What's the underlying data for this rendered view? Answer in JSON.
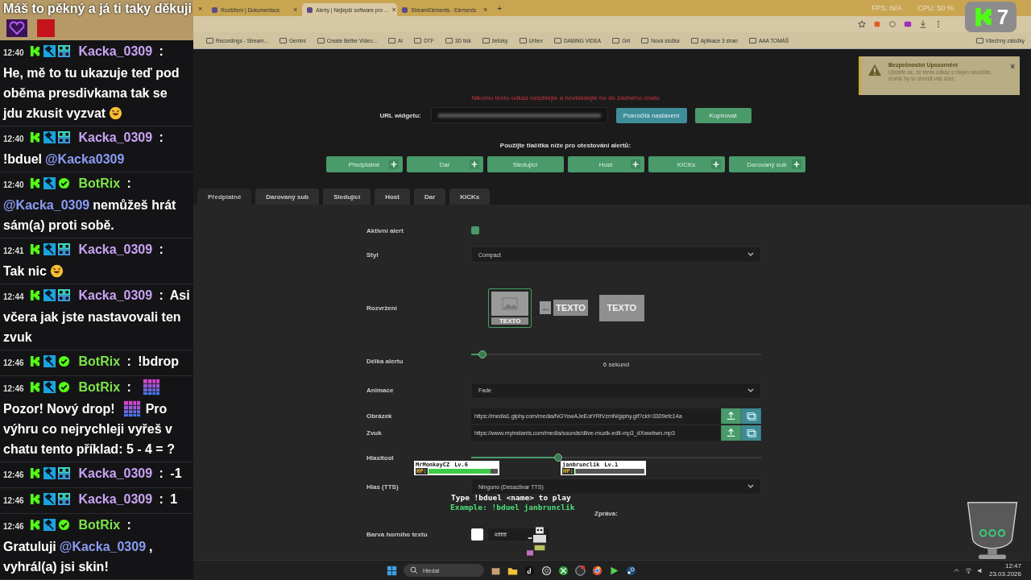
{
  "chat": {
    "header": "Máš to pěkný a já ti taky děkuji",
    "messages": [
      {
        "time": "12:40",
        "badges": [
          {
            "kind": "kick"
          },
          {
            "kind": "mod"
          },
          {
            "kind": "og"
          }
        ],
        "user": "Kacka_0309",
        "color": "#c9a3f2",
        "separator": ":",
        "parts": [
          {
            "kind": "text",
            "text": "He, mě to tu ukazuje teď pod oběma presdivkama tak se jdu zkusit vyzvat"
          },
          {
            "kind": "laugh-emote"
          }
        ]
      },
      {
        "time": "12:40",
        "badges": [
          {
            "kind": "kick"
          },
          {
            "kind": "mod"
          },
          {
            "kind": "og"
          }
        ],
        "user": "Kacka_0309",
        "color": "#c9a3f2",
        "separator": ":",
        "parts": [
          {
            "kind": "text",
            "text": "!bduel"
          },
          {
            "kind": "mention",
            "text": "@Kacka0309"
          }
        ]
      },
      {
        "time": "12:40",
        "badges": [
          {
            "kind": "kick"
          },
          {
            "kind": "mod"
          },
          {
            "kind": "verified"
          }
        ],
        "user": "BotRix",
        "color": "#7de34a",
        "separator": ":",
        "parts": [
          {
            "kind": "mention",
            "text": "@Kacka_0309"
          },
          {
            "kind": "text",
            "text": "nemůžeš hrát sám(a) proti sobě."
          }
        ]
      },
      {
        "time": "12:41",
        "badges": [
          {
            "kind": "kick"
          },
          {
            "kind": "mod"
          },
          {
            "kind": "og"
          }
        ],
        "user": "Kacka_0309",
        "color": "#c9a3f2",
        "separator": ":",
        "parts": [
          {
            "kind": "text",
            "text": "Tak nic"
          },
          {
            "kind": "laugh-emote"
          }
        ]
      },
      {
        "time": "12:44",
        "badges": [
          {
            "kind": "kick"
          },
          {
            "kind": "mod"
          },
          {
            "kind": "og"
          }
        ],
        "user": "Kacka_0309",
        "color": "#c9a3f2",
        "separator": ":",
        "parts": [
          {
            "kind": "text",
            "text": "Asi včera jak jste nastavovali ten zvuk"
          }
        ]
      },
      {
        "time": "12:46",
        "badges": [
          {
            "kind": "kick"
          },
          {
            "kind": "mod"
          },
          {
            "kind": "verified"
          }
        ],
        "user": "BotRix",
        "color": "#7de34a",
        "separator": ":",
        "parts": [
          {
            "kind": "text",
            "text": "!bdrop"
          }
        ]
      },
      {
        "time": "12:46",
        "badges": [
          {
            "kind": "kick"
          },
          {
            "kind": "mod"
          },
          {
            "kind": "verified"
          }
        ],
        "user": "BotRix",
        "color": "#7de34a",
        "separator": ":",
        "parts": [
          {
            "kind": "pixel-emote"
          },
          {
            "kind": "text",
            "text": "Pozor! Nový drop!"
          },
          {
            "kind": "pixel-emote"
          },
          {
            "kind": "text",
            "text": "Pro výhru co nejrychleji vyřeš v chatu tento příklad: 5 - 4 = ?"
          }
        ]
      },
      {
        "time": "12:46",
        "badges": [
          {
            "kind": "kick"
          },
          {
            "kind": "mod"
          },
          {
            "kind": "og"
          }
        ],
        "user": "Kacka_0309",
        "color": "#c9a3f2",
        "separator": ":",
        "parts": [
          {
            "kind": "text",
            "text": "-1"
          }
        ]
      },
      {
        "time": "12:46",
        "badges": [
          {
            "kind": "kick"
          },
          {
            "kind": "mod"
          },
          {
            "kind": "og"
          }
        ],
        "user": "Kacka_0309",
        "color": "#c9a3f2",
        "separator": ":",
        "parts": [
          {
            "kind": "text",
            "text": "1"
          }
        ]
      },
      {
        "time": "12:46",
        "badges": [
          {
            "kind": "kick"
          },
          {
            "kind": "mod"
          },
          {
            "kind": "verified"
          }
        ],
        "user": "BotRix",
        "color": "#7de34a",
        "separator": ":",
        "parts": [
          {
            "kind": "text",
            "text": "Gratuluji"
          },
          {
            "kind": "mention",
            "text": "@Kacka_0309"
          },
          {
            "kind": "text",
            "text": ", vyhrál(a) jsi skin!"
          }
        ]
      }
    ]
  },
  "browser": {
    "leading_close": "×",
    "new_tab": "+",
    "tabs": [
      {
        "title": "Rozšíření | Dokumentace",
        "close": "×",
        "selected": false
      },
      {
        "title": "Alerty | Nejlepší software pro ...",
        "close": "×",
        "selected": true
      },
      {
        "title": "StreamElements - Elements",
        "close": "×",
        "selected": false
      }
    ],
    "bookmarks": [
      "Recordings - Stream...",
      "Gemini",
      "Create Better Video...",
      "AI",
      "DTF",
      "3D tisk",
      "želízky",
      "Urbex",
      "DABING VIDEA",
      "Gril",
      "Nová složka",
      "Aplikace 3 stran",
      "AAA TOMÁŠ"
    ],
    "all_bookmarks": "Všechny záložky"
  },
  "stream_stats": {
    "fps": "FPS: N/A",
    "cpu": "CPU: 50 %",
    "badge": "7"
  },
  "page": {
    "warning": "Nikomu tento odkaz nesdílejte a nevkládejte ho do žádného chatu",
    "url_label": "URL widgetu:",
    "url_buttons": [
      {
        "label": "Pokročilá nastavení",
        "kind": "info"
      },
      {
        "label": "Kopírovat",
        "kind": "primary"
      }
    ],
    "test_heading": "Použijte tlačítka níže pro otestování alertů:",
    "test_buttons": [
      {
        "label": "Předplatné",
        "plus": true
      },
      {
        "label": "Dar",
        "plus": true
      },
      {
        "label": "Sledující",
        "plus": false
      },
      {
        "label": "Host",
        "plus": true
      },
      {
        "label": "KICKs",
        "plus": true
      },
      {
        "label": "Darovaný sub",
        "plus": true
      }
    ],
    "tabs": [
      {
        "label": "Předplatné",
        "selected": true
      },
      {
        "label": "Darovaný sub",
        "selected": false
      },
      {
        "label": "Sledující",
        "selected": false
      },
      {
        "label": "Host",
        "selected": false
      },
      {
        "label": "Dar",
        "selected": false
      },
      {
        "label": "KICKs",
        "selected": false
      }
    ],
    "fields": [
      {
        "kind": "checkbox",
        "label": "Aktivní alert",
        "checked": true
      },
      {
        "kind": "select",
        "label": "Styl",
        "value": "Compact"
      },
      {
        "kind": "layout",
        "label": "Rozvržení",
        "options": [
          {
            "kind": "stacked",
            "text": "TEXTO",
            "selected": true
          },
          {
            "kind": "side",
            "text": "TEXTO",
            "selected": false
          },
          {
            "kind": "overlay",
            "text": "TEXTO",
            "selected": false
          }
        ]
      },
      {
        "kind": "slider",
        "label": "Délka alertu",
        "level": 0.04,
        "reading": "6  sekund"
      },
      {
        "kind": "select",
        "label": "Animace",
        "value": "Fade"
      },
      {
        "kind": "file",
        "label": "Obrázek",
        "value": "https://media1.giphy.com/media/NGYowAJeEotYRtVzmN/giphy.gif?cid=3309efc14a"
      },
      {
        "kind": "file",
        "label": "Zvuk",
        "value": "https://www.myinstants.com/media/sounds/dlive-muzik-edit-mp3_dXwwbwn.mp3"
      },
      {
        "kind": "slider",
        "label": "Hlasitost",
        "level": 0.3
      },
      {
        "kind": "select",
        "label": "Hlas (TTS)",
        "value": "Ninguno (Desactivar TTS)"
      },
      {
        "kind": "heading",
        "label": "Zpráva:"
      },
      {
        "kind": "color",
        "label": "Barva horního textu",
        "value": "#ffffff"
      }
    ]
  },
  "toast": {
    "title": "Bezpečnostní Upozornění",
    "body": "Ujistěte se, že tento odkaz s nikým nesdílíte, mohlo by to ohrozit váš účet.",
    "close": "×"
  },
  "duel": {
    "players": [
      {
        "name": "MrMonkeyCZ",
        "lv": "Lv.6",
        "hp": "HP:",
        "level": 0.9
      },
      {
        "name": "janbrunclik",
        "lv": "Lv.1",
        "hp": "HP:",
        "level": 0
      }
    ],
    "instruction": "Type !bduel <name> to play",
    "example": "Example: !bduel janbrunclik"
  },
  "taskbar": {
    "search": "Hledat",
    "time": "12:47",
    "date": "23.03.2026"
  }
}
